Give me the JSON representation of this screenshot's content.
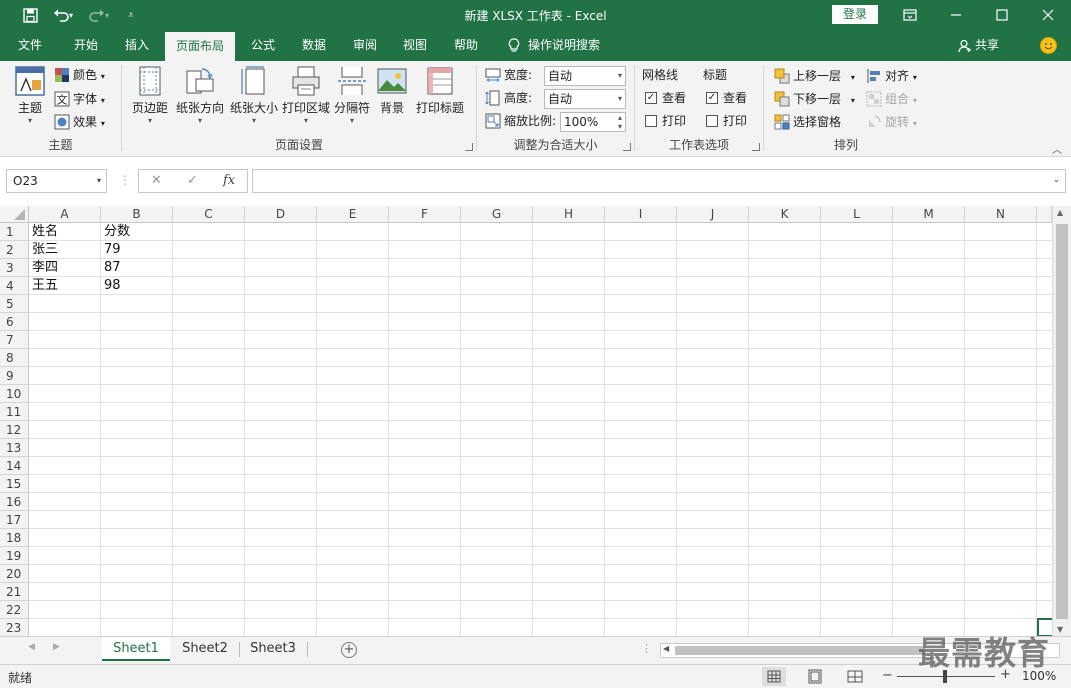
{
  "window": {
    "title": "新建 XLSX 工作表  -  Excel",
    "login_label": "登录",
    "controls": [
      "ribbon-display-icon",
      "minimize-icon",
      "maximize-icon",
      "close-icon"
    ]
  },
  "quick_access": [
    "save-icon",
    "undo-icon",
    "redo-icon",
    "customize-icon"
  ],
  "tabs": [
    {
      "label": "文件"
    },
    {
      "label": "开始"
    },
    {
      "label": "插入"
    },
    {
      "label": "页面布局",
      "active": true
    },
    {
      "label": "公式"
    },
    {
      "label": "数据"
    },
    {
      "label": "审阅"
    },
    {
      "label": "视图"
    },
    {
      "label": "帮助"
    }
  ],
  "tell_me": "操作说明搜索",
  "share": "共享",
  "ribbon": {
    "themes": {
      "label": "主题",
      "theme_btn": "主题",
      "colors": "颜色",
      "fonts": "字体",
      "effects": "效果"
    },
    "page_setup": {
      "label": "页面设置",
      "buttons": [
        "页边距",
        "纸张方向",
        "纸张大小",
        "打印区域",
        "分隔符",
        "背景",
        "打印标题"
      ]
    },
    "scale_to_fit": {
      "label": "调整为合适大小",
      "width_label": "宽度:",
      "width_value": "自动",
      "height_label": "高度:",
      "height_value": "自动",
      "scale_label": "缩放比例:",
      "scale_value": "100%"
    },
    "sheet_options": {
      "label": "工作表选项",
      "gridlines": "网格线",
      "headings": "标题",
      "view": "查看",
      "print": "打印"
    },
    "arrange": {
      "label": "排列",
      "bring_forward": "上移一层",
      "send_backward": "下移一层",
      "selection_pane": "选择窗格",
      "align": "对齐",
      "group": "组合",
      "rotate": "旋转"
    }
  },
  "formula_bar": {
    "name_box": "O23",
    "fx": "fx",
    "cancel": "✕",
    "enter": "✓",
    "formula": ""
  },
  "grid": {
    "columns": [
      "A",
      "B",
      "C",
      "D",
      "E",
      "F",
      "G",
      "H",
      "I",
      "J",
      "K",
      "L",
      "M",
      "N"
    ],
    "rows": [
      "1",
      "2",
      "3",
      "4",
      "5",
      "6",
      "7",
      "8",
      "9",
      "10",
      "11",
      "12",
      "13",
      "14",
      "15",
      "16",
      "17",
      "18",
      "19",
      "20",
      "21",
      "22",
      "23"
    ],
    "cells": [
      [
        "姓名",
        "分数"
      ],
      [
        "张三",
        "79"
      ],
      [
        "李四",
        "87"
      ],
      [
        "王五",
        "98"
      ]
    ]
  },
  "sheets": [
    {
      "name": "Sheet1",
      "active": true
    },
    {
      "name": "Sheet2"
    },
    {
      "name": "Sheet3"
    }
  ],
  "status": {
    "text": "就绪",
    "zoom": "100%"
  },
  "watermark": "最需教育",
  "colors": {
    "accent": "#217346",
    "ribbon_bg": "#f3f3f3"
  }
}
